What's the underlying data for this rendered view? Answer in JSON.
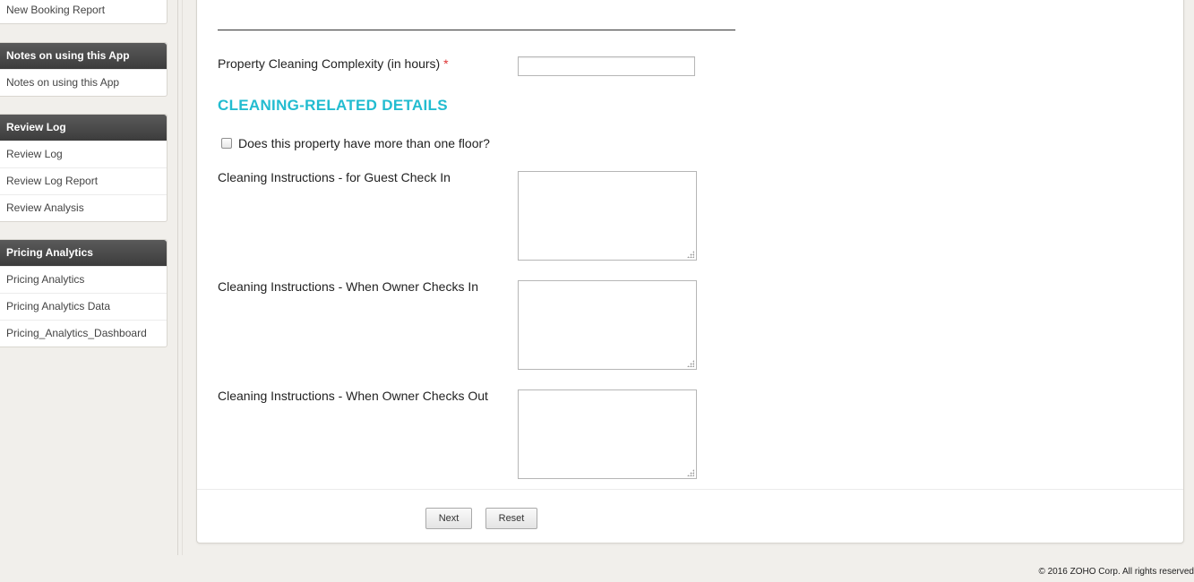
{
  "sidebar": {
    "top_item": "New Booking Report",
    "sections": [
      {
        "title": "Notes on using this App",
        "items": [
          "Notes on using this App"
        ]
      },
      {
        "title": "Review Log",
        "items": [
          "Review Log",
          "Review Log Report",
          "Review Analysis"
        ]
      },
      {
        "title": "Pricing Analytics",
        "items": [
          "Pricing Analytics",
          "Pricing Analytics Data",
          "Pricing_Analytics_Dashboard"
        ]
      }
    ]
  },
  "form": {
    "complexity_label": "Property Cleaning Complexity (in hours)",
    "required_mark": "*",
    "complexity_value": "",
    "section_title": "CLEANING-RELATED DETAILS",
    "multi_floor_label": "Does this property have more than one floor?",
    "multi_floor_checked": false,
    "guest_checkin_label": "Cleaning Instructions - for Guest Check In",
    "owner_checkin_label": "Cleaning Instructions - When Owner Checks In",
    "owner_checkout_label": "Cleaning Instructions - When Owner Checks Out",
    "next_label": "Next",
    "reset_label": "Reset"
  },
  "footer": {
    "copyright": "© 2016 ZOHO Corp. All rights reserved"
  },
  "colors": {
    "section_title": "#22bcd0",
    "sidebar_header": "#444444",
    "required": "#dd3333"
  }
}
